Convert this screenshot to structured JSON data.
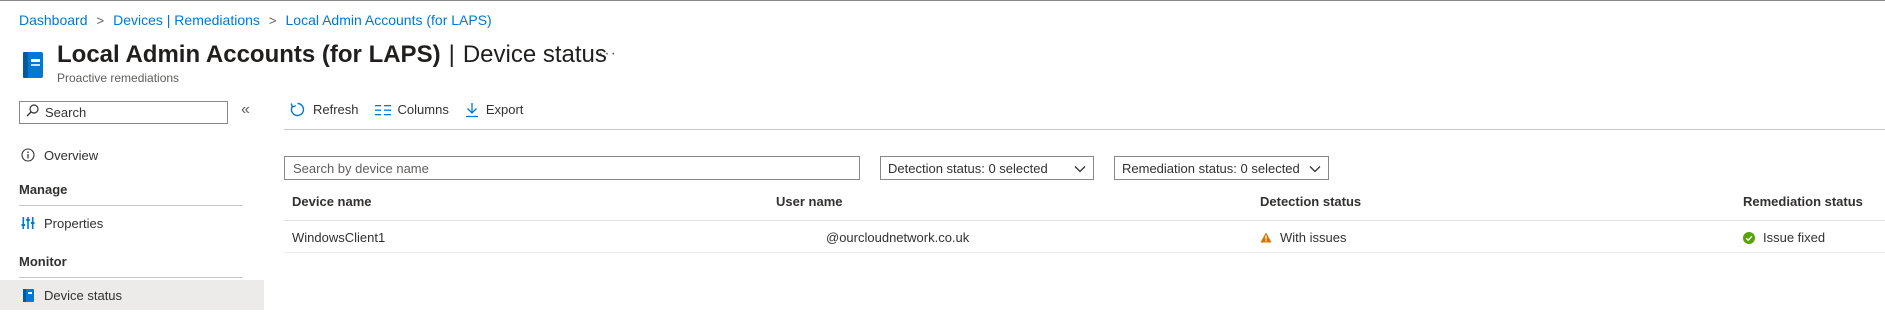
{
  "breadcrumb": {
    "items": [
      "Dashboard",
      "Devices | Remediations",
      "Local Admin Accounts (for LAPS)"
    ],
    "separator": ">"
  },
  "header": {
    "title": "Local Admin Accounts (for LAPS)",
    "separator": "|",
    "page": "Device status",
    "subtitle": "Proactive remediations",
    "more": "···",
    "icon": "script-book-icon"
  },
  "sidebar": {
    "search_placeholder": "Search",
    "collapse": "«",
    "overview": "Overview",
    "manage_section": "Manage",
    "properties": "Properties",
    "monitor_section": "Monitor",
    "device_status": "Device status"
  },
  "toolbar": {
    "refresh": "Refresh",
    "columns": "Columns",
    "export": "Export"
  },
  "filters": {
    "device_search_placeholder": "Search by device name",
    "detection_filter": "Detection status: 0 selected",
    "remediation_filter": "Remediation status: 0 selected"
  },
  "table": {
    "columns": [
      "Device name",
      "User name",
      "Detection status",
      "Remediation status"
    ],
    "rows": [
      {
        "device": "WindowsClient1",
        "user": "@ourcloudnetwork.co.uk",
        "detection": "With issues",
        "remediation": "Issue fixed"
      }
    ]
  },
  "colors": {
    "link": "#0078d4",
    "warning": "#d47500",
    "success": "#57a300",
    "selected_bg": "#edebe9"
  }
}
